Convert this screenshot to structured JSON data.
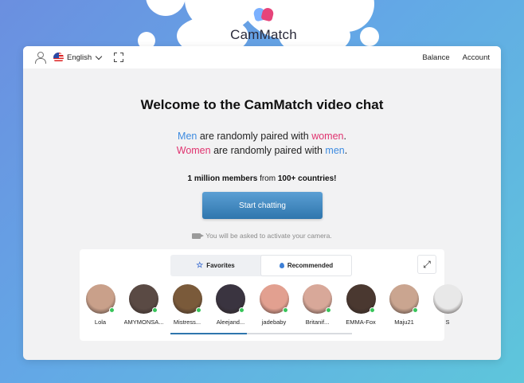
{
  "brand": {
    "name": "CamMatch"
  },
  "topbar": {
    "language": "English",
    "right_links": [
      "Balance",
      "Account"
    ]
  },
  "hero": {
    "title": "Welcome to the CamMatch video chat",
    "line1": {
      "a": "Men",
      "b": " are randomly paired with ",
      "c": "women",
      "d": "."
    },
    "line2": {
      "a": "Women",
      "b": " are randomly paired with ",
      "c": "men",
      "d": "."
    },
    "members": {
      "a": "1 million members",
      "b": " from ",
      "c": "100+ countries!"
    },
    "start_button": "Start chatting",
    "camera_note": "You will be asked to activate your camera."
  },
  "tabs": [
    {
      "label": "Favorites",
      "icon": "star-icon"
    },
    {
      "label": "Recommended",
      "icon": "flame-icon",
      "active": true
    }
  ],
  "carousel": {
    "scroll_progress": 0.42,
    "items": [
      {
        "name": "Lola",
        "color": "#c9a08a",
        "online": true
      },
      {
        "name": "AMYMONSA...",
        "color": "#5a4a44",
        "online": true
      },
      {
        "name": "Mistress...",
        "color": "#7a5a3a",
        "online": true
      },
      {
        "name": "Aleejand...",
        "color": "#3a3440",
        "online": true
      },
      {
        "name": "jadebaby",
        "color": "#e2a090",
        "online": true
      },
      {
        "name": "Britanif...",
        "color": "#d8a899",
        "online": true
      },
      {
        "name": "EMMA-Fox",
        "color": "#4a3830",
        "online": true
      },
      {
        "name": "Maju21",
        "color": "#caa590",
        "online": true
      },
      {
        "name": "S",
        "color": "#e8e8e8",
        "online": false
      }
    ]
  }
}
